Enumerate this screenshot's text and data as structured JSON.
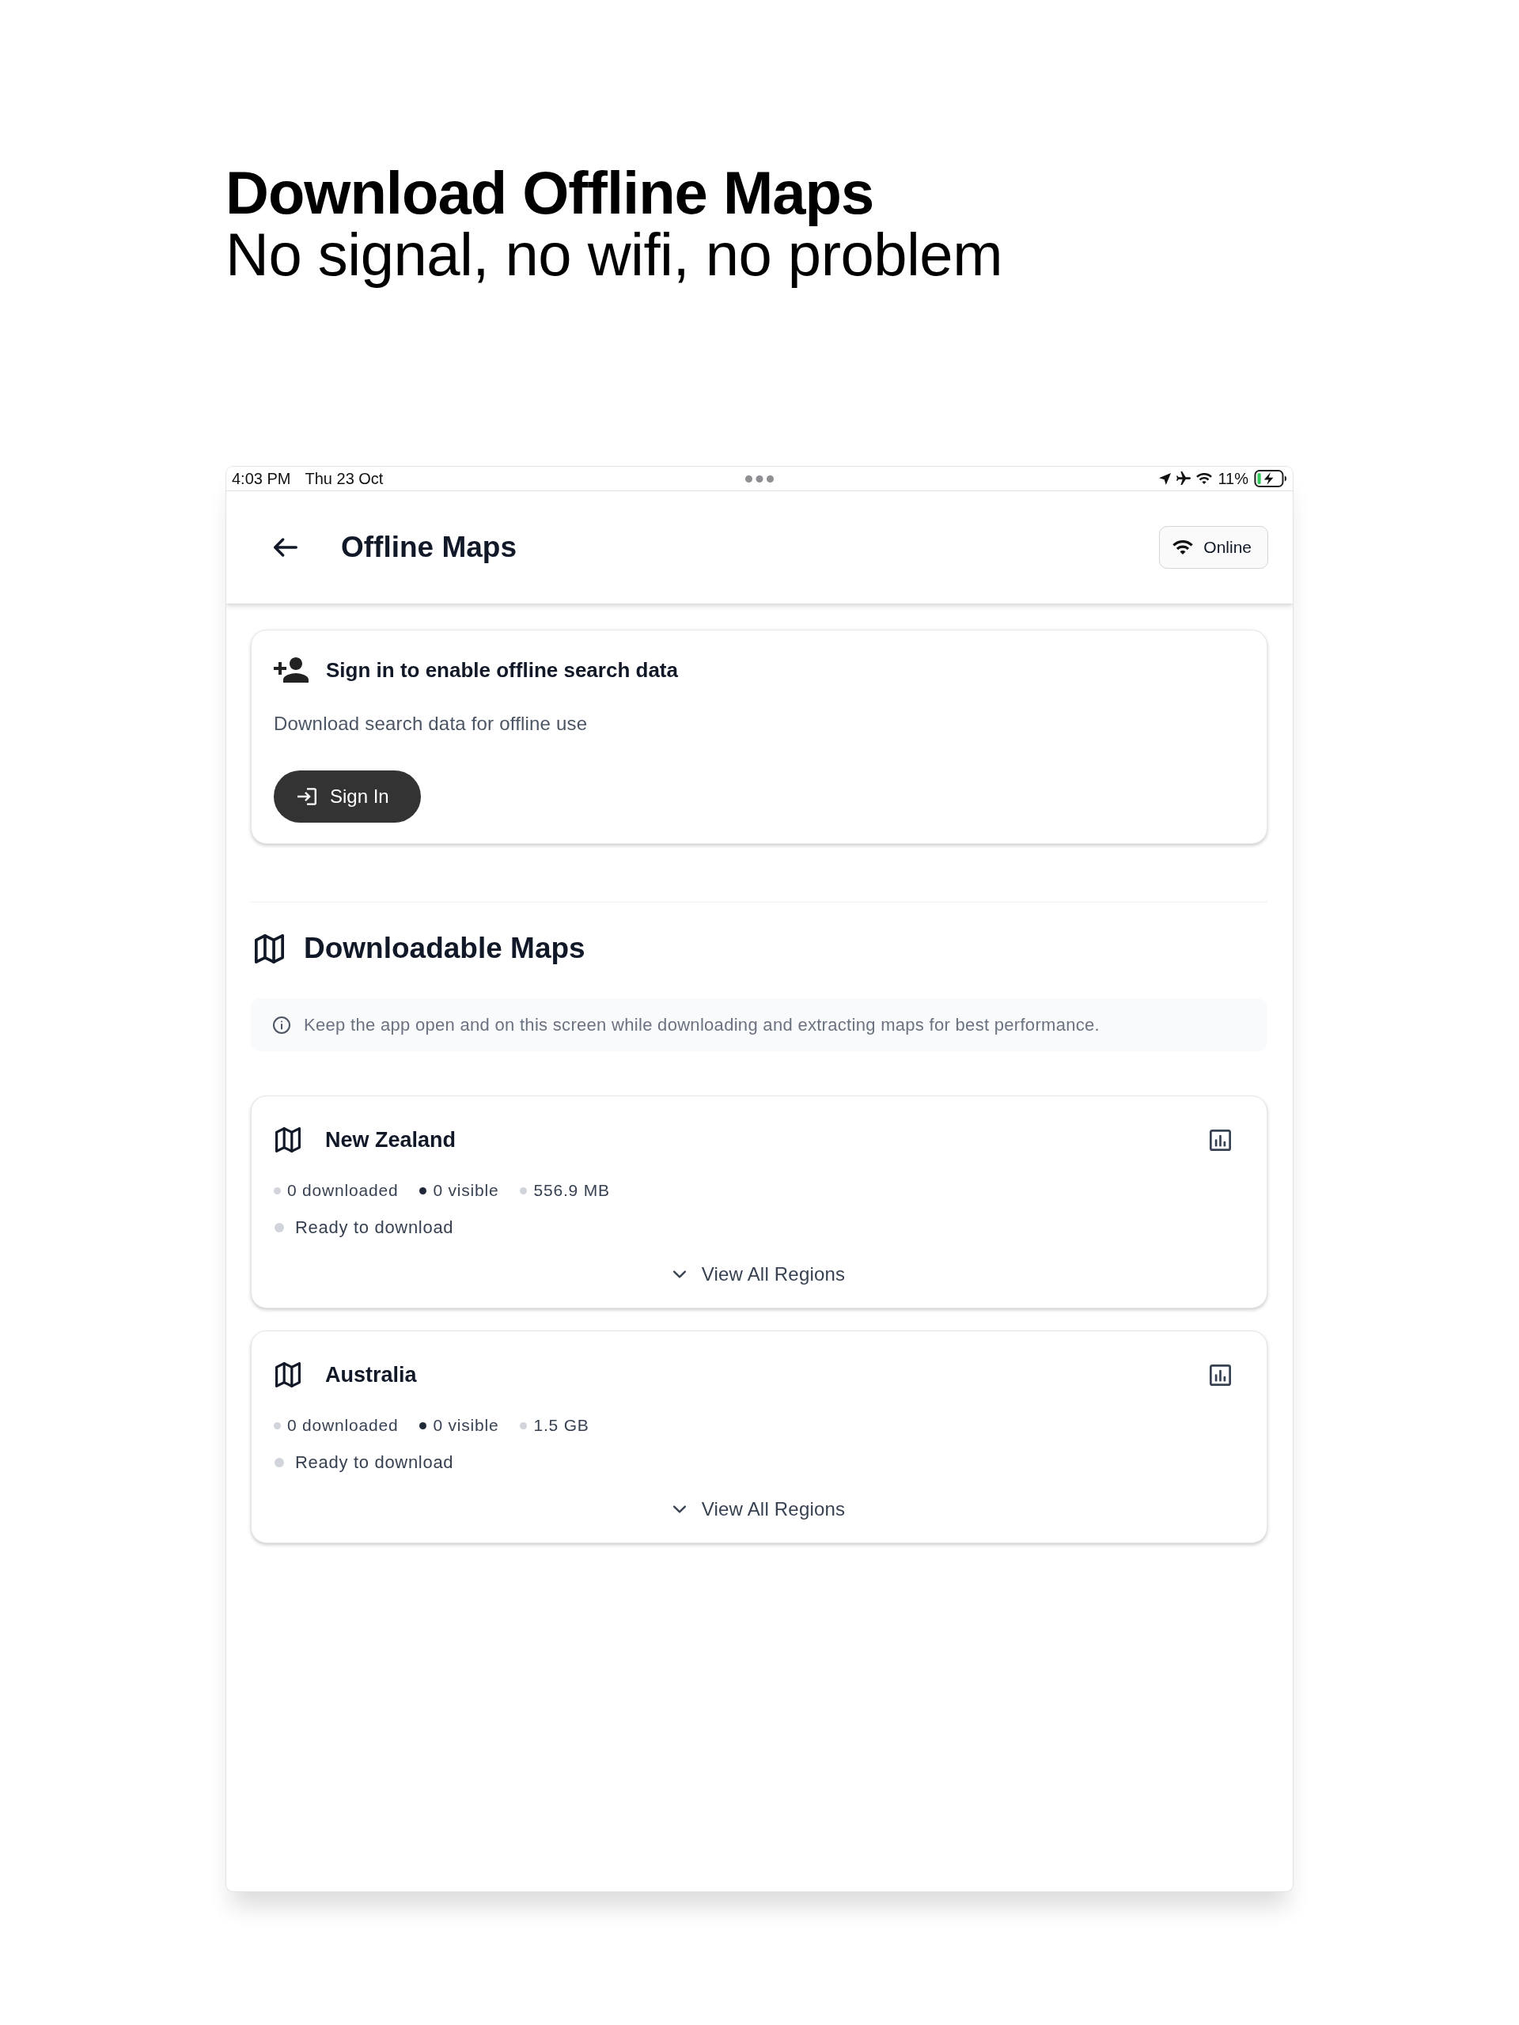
{
  "promo": {
    "headline": "Download Offline Maps",
    "subheadline": "No signal, no wifi, no problem"
  },
  "status_bar": {
    "time": "4:03 PM",
    "date": "Thu 23 Oct",
    "battery": "11%"
  },
  "header": {
    "title": "Offline Maps",
    "connection": "Online"
  },
  "sign_in_card": {
    "title": "Sign in to enable offline search data",
    "description": "Download search data for offline use",
    "button": "Sign In"
  },
  "downloadable_maps": {
    "heading": "Downloadable Maps",
    "notice": "Keep the app open and on this screen while downloading and extracting maps for best performance.",
    "regions": [
      {
        "name": "New Zealand",
        "stats": [
          {
            "text": "0 downloaded",
            "color": "#d1d5db"
          },
          {
            "text": "0 visible",
            "color": "#1f2937"
          },
          {
            "text": "556.9 MB",
            "color": "#d1d5db"
          }
        ],
        "status": {
          "text": "Ready to download",
          "color": "#d1d5db"
        },
        "toggle": "View All Regions",
        "expanded": false
      },
      {
        "name": "Australia",
        "stats": [
          {
            "text": "0 downloaded",
            "color": "#d1d5db"
          },
          {
            "text": "0 visible",
            "color": "#1f2937"
          },
          {
            "text": "1.5 GB",
            "color": "#d1d5db"
          }
        ],
        "status": {
          "text": "Ready to download",
          "color": "#d1d5db"
        },
        "toggle": "View All Regions",
        "expanded": false
      }
    ]
  }
}
